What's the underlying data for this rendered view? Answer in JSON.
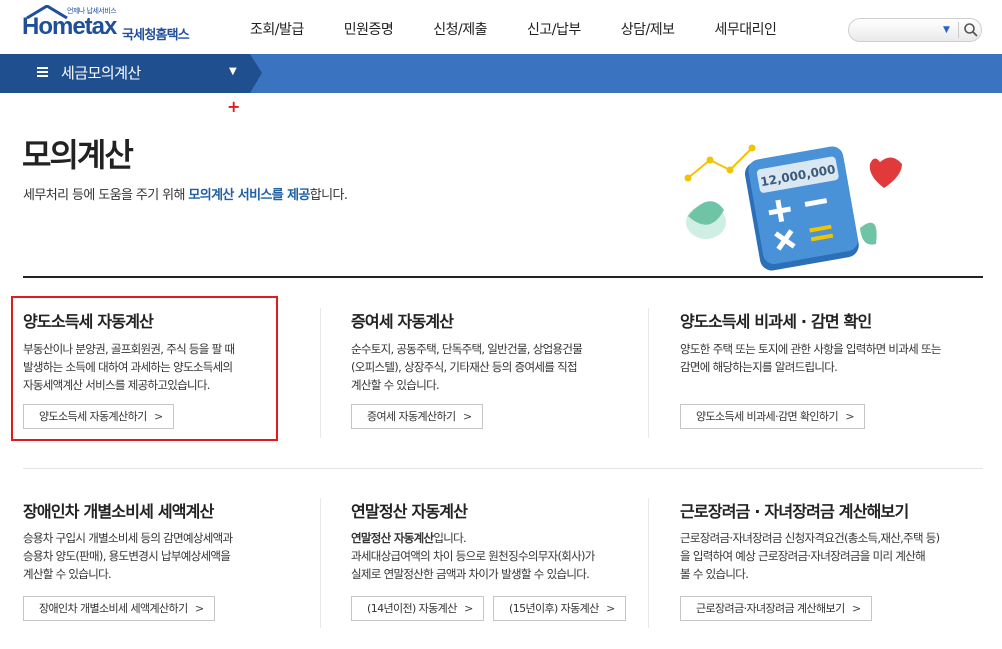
{
  "logo": {
    "small": "언제나 납세서비스",
    "brand": "Hometax",
    "ko": "국세청홈택스"
  },
  "gnb": [
    "조회/발급",
    "민원증명",
    "신청/제출",
    "신고/납부",
    "상담/제보",
    "세무대리인"
  ],
  "search": {
    "placeholder": ""
  },
  "subnav": {
    "title": "세금모의계산"
  },
  "page": {
    "title": "모의계산",
    "desc_pre": "세무처리 등에 도움을 주기 위해 ",
    "desc_hl": "모의계산 서비스를 제공",
    "desc_post": "합니다."
  },
  "illustration": {
    "amount": "12,000,000"
  },
  "cards": [
    {
      "title": "양도소득세 자동계산",
      "body": "부동산이나 분양권, 골프회원권, 주식 등을 팔 때\n발생하는 소득에 대하여 과세하는 양도소득세의\n자동세액계산 서비스를 제공하고있습니다.",
      "buttons": [
        "양도소득세 자동계산하기"
      ]
    },
    {
      "title": "증여세 자동계산",
      "body": "순수토지, 공동주택, 단독주택, 일반건물, 상업용건물\n(오피스텔), 상장주식, 기타재산 등의 증여세를 직접\n계산할 수 있습니다.",
      "buttons": [
        "증여세 자동계산하기"
      ]
    },
    {
      "title": "양도소득세 비과세 · 감면 확인",
      "body": "양도한 주택 또는 토지에 관한 사항을 입력하면 비과세 또는\n감면에 해당하는지를 알려드립니다.",
      "buttons": [
        "양도소득세 비과세·감면 확인하기"
      ]
    },
    {
      "title": "장애인차 개별소비세 세액계산",
      "body": "승용차 구입시 개별소비세 등의 감면예상세액과\n승용차 양도(판매), 용도변경시 납부예상세액을\n계산할 수 있습니다.",
      "buttons": [
        "장애인차 개별소비세 세액계산하기"
      ]
    },
    {
      "title": "연말정산 자동계산",
      "body_bold": "연말정산 자동계산",
      "body_bold_tail": "입니다.",
      "body": "과세대상급여액의 차이 등으로 원천징수의무자(회사)가\n실제로 연말정산한 금액과 차이가 발생할 수 있습니다.",
      "buttons": [
        "(14년이전) 자동계산",
        "(15년이후) 자동계산"
      ]
    },
    {
      "title": "근로장려금 · 자녀장려금 계산해보기",
      "body": "근로장려금·자녀장려금 신청자격요건(총소득,재산,주택 등)\n을 입력하여 예상 근로장려금·자녀장려금을 미리 계산해\n볼 수 있습니다.",
      "buttons": [
        "근로장려금·자녀장려금 계산해보기"
      ]
    }
  ],
  "colors": {
    "brand": "#1f4e9b",
    "subnav": "#3a73c0",
    "subnav_dark": "#204f8f",
    "highlight": "#1d5fa8",
    "annotation": "#e21a1a"
  },
  "icons": [
    "search-icon",
    "menu-icon",
    "chevron-down-icon",
    "chevron-right-icon",
    "calculator-illustration"
  ]
}
